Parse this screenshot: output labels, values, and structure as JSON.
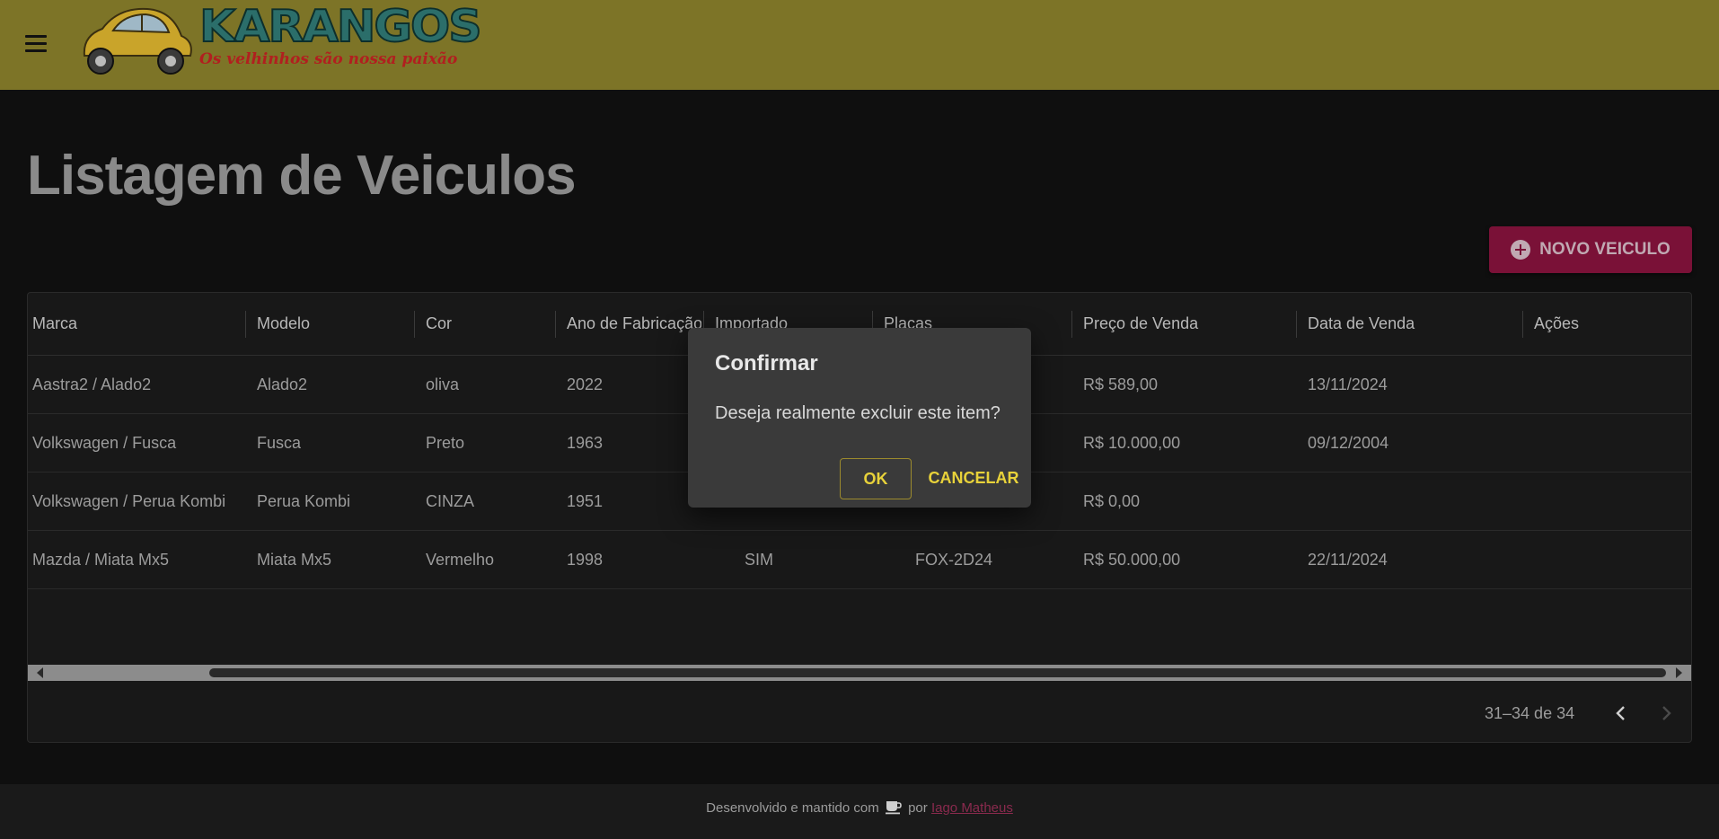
{
  "header": {
    "logo_title": "KARANGOS",
    "logo_tagline": "Os velhinhos são nossa paixão"
  },
  "page": {
    "title": "Listagem de Veiculos",
    "new_button_label": "NOVO VEICULO"
  },
  "table": {
    "columns": [
      "Marca",
      "Modelo",
      "Cor",
      "Ano de Fabricação",
      "Importado",
      "Placas",
      "Preço de Venda",
      "Data de Venda",
      "Ações"
    ],
    "rows": [
      [
        "Aastra2 / Alado2",
        "Alado2",
        "oliva",
        "2022",
        "",
        "",
        "R$ 589,00",
        "13/11/2024",
        ""
      ],
      [
        "Volkswagen / Fusca",
        "Fusca",
        "Preto",
        "1963",
        "",
        "",
        "R$ 10.000,00",
        "09/12/2004",
        ""
      ],
      [
        "Volkswagen / Perua Kombi",
        "Perua Kombi",
        "CINZA",
        "1951",
        "",
        "",
        "R$ 0,00",
        "",
        ""
      ],
      [
        "Mazda / Miata Mx5",
        "Miata Mx5",
        "Vermelho",
        "1998",
        "SIM",
        "FOX-2D24",
        "R$ 50.000,00",
        "22/11/2024",
        ""
      ]
    ],
    "pagination": "31–34 de 34"
  },
  "dialog": {
    "title": "Confirmar",
    "message": "Deseja realmente excluir este item?",
    "ok_label": "OK",
    "cancel_label": "CANCELAR"
  },
  "footer": {
    "text_before": "Desenvolvido e mantido com",
    "text_by": "por",
    "author": "Iago Matheus"
  },
  "colors": {
    "appbar": "#7d7427",
    "accent_button": "#7a1137",
    "dialog_action": "#e8d23a"
  }
}
